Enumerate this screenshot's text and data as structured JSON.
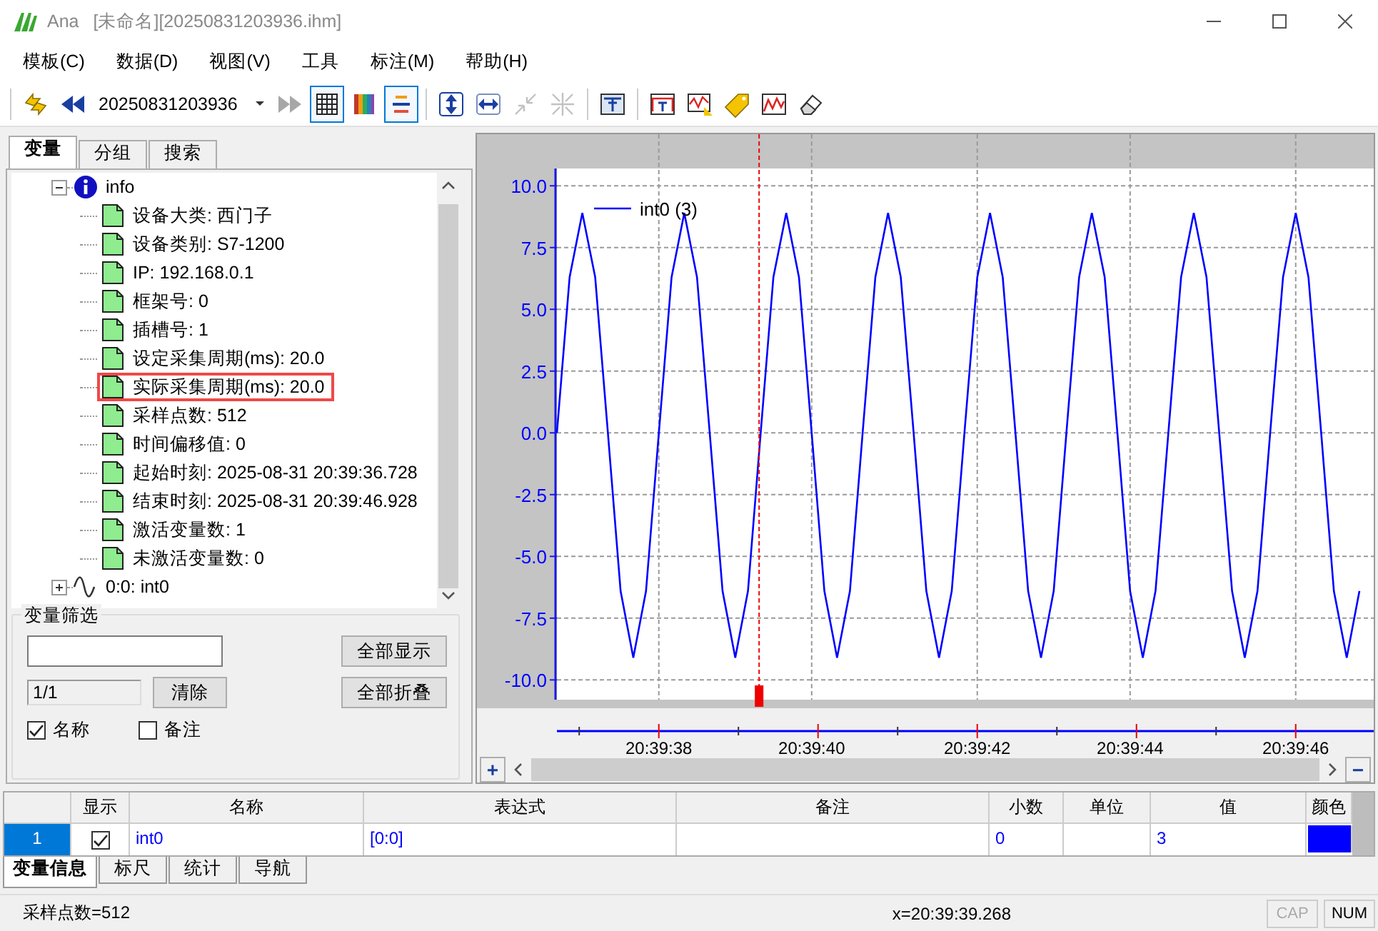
{
  "window": {
    "app": "Ana",
    "document": "[未命名][20250831203936.ihm]"
  },
  "menu": [
    "模板(C)",
    "数据(D)",
    "视图(V)",
    "工具",
    "标注(M)",
    "帮助(H)"
  ],
  "toolbar": {
    "combo_value": "20250831203936",
    "buttons": [
      {
        "pressed": false,
        "disabled": false
      },
      {
        "pressed": false,
        "disabled": false
      },
      {
        "pressed": false,
        "disabled": true
      },
      {
        "pressed": true,
        "disabled": false
      },
      {
        "pressed": false,
        "disabled": false
      },
      {
        "pressed": true,
        "disabled": false
      },
      {
        "pressed": false,
        "disabled": false
      },
      {
        "pressed": false,
        "disabled": false
      },
      {
        "pressed": false,
        "disabled": true
      },
      {
        "pressed": false,
        "disabled": true
      },
      {
        "pressed": false,
        "disabled": false
      },
      {
        "pressed": false,
        "disabled": false
      },
      {
        "pressed": false,
        "disabled": false
      },
      {
        "pressed": false,
        "disabled": false
      },
      {
        "pressed": false,
        "disabled": false
      },
      {
        "pressed": false,
        "disabled": false
      }
    ]
  },
  "left_tabs": [
    {
      "label": "变量",
      "selected": true
    },
    {
      "label": "分组",
      "selected": false
    },
    {
      "label": "搜索",
      "selected": false
    }
  ],
  "tree": [
    {
      "label": "info",
      "kind": "info",
      "expanded": true,
      "children": [
        {
          "label": "设备大类: 西门子",
          "highlighted": false
        },
        {
          "label": "设备类别: S7-1200",
          "highlighted": false
        },
        {
          "label": "IP: 192.168.0.1",
          "highlighted": false
        },
        {
          "label": "框架号: 0",
          "highlighted": false
        },
        {
          "label": "插槽号: 1",
          "highlighted": false
        },
        {
          "label": "设定采集周期(ms): 20.0",
          "highlighted": false
        },
        {
          "label": "实际采集周期(ms): 20.0",
          "highlighted": true
        },
        {
          "label": "采样点数: 512",
          "highlighted": false
        },
        {
          "label": "时间偏移值: 0",
          "highlighted": false
        },
        {
          "label": "起始时刻: 2025-08-31 20:39:36.728",
          "highlighted": false
        },
        {
          "label": "结束时刻: 2025-08-31 20:39:46.928",
          "highlighted": false
        },
        {
          "label": "激活变量数: 1",
          "highlighted": false
        },
        {
          "label": "未激活变量数: 0",
          "highlighted": false
        }
      ]
    },
    {
      "label": "0:0: int0",
      "kind": "signal",
      "expanded": false
    }
  ],
  "filter": {
    "title": "变量筛选",
    "count": "1/1",
    "clear_button": "清除",
    "show_all_button": "全部显示",
    "collapse_all_button": "全部折叠",
    "checkboxes": [
      {
        "label": "名称",
        "checked": true
      },
      {
        "label": "备注",
        "checked": false
      }
    ]
  },
  "chart_data": {
    "type": "line",
    "categories": [
      null,
      null,
      null,
      null,
      null,
      null,
      null,
      null,
      "20:39:38",
      null,
      null,
      null,
      null,
      null,
      null,
      null,
      null,
      null,
      null,
      null,
      "20:39:40",
      null,
      null,
      null,
      null,
      null,
      null,
      null,
      null,
      null,
      null,
      null,
      null,
      "20:39:42",
      null,
      null,
      null,
      null,
      null,
      null,
      null,
      null,
      null,
      null,
      null,
      "20:39:44",
      null,
      null,
      null,
      null,
      null,
      null,
      null,
      null,
      null,
      null,
      null,
      null,
      "20:39:46",
      null,
      null,
      null,
      null,
      null
    ],
    "series": [
      {
        "name": "int0 (3)",
        "color": "#0000ff",
        "values": [
          0,
          6.3,
          8.9,
          6.3,
          0,
          -6.4,
          -9.1,
          -6.4,
          0,
          6.3,
          8.9,
          6.3,
          0,
          -6.4,
          -9.1,
          -6.4,
          0,
          6.3,
          8.9,
          6.3,
          0,
          -6.4,
          -9.1,
          -6.4,
          0,
          6.3,
          8.9,
          6.3,
          0,
          -6.4,
          -9.1,
          -6.4,
          0,
          6.3,
          8.9,
          6.3,
          0,
          -6.4,
          -9.1,
          -6.4,
          0,
          6.3,
          8.9,
          6.3,
          0,
          -6.4,
          -9.1,
          -6.4,
          0,
          6.3,
          8.9,
          6.3,
          0,
          -6.4,
          -9.1,
          -6.4,
          0,
          6.3,
          8.9,
          6.3,
          0,
          -6.4,
          -9.1,
          -6.4
        ]
      }
    ],
    "ylim": [
      -10.8,
      10.7
    ],
    "yticks": [
      {
        "value": 10,
        "label": "10.0"
      },
      {
        "value": 7.5,
        "label": "7.5"
      },
      {
        "value": 5,
        "label": "5.0"
      },
      {
        "value": 2.5,
        "label": "2.5"
      },
      {
        "value": 0,
        "label": "0.0"
      },
      {
        "value": -2.5,
        "label": "-2.5"
      },
      {
        "value": -5,
        "label": "-5.0"
      },
      {
        "value": -7.5,
        "label": "-7.5"
      },
      {
        "value": -10,
        "label": "-10.0"
      }
    ],
    "grid": true
  },
  "chart_scroll": {
    "zoom_in": "+",
    "zoom_out": "−"
  },
  "table": {
    "columns": [
      "显示",
      "名称",
      "表达式",
      "备注",
      "小数",
      "单位",
      "值",
      "颜色"
    ],
    "rows": [
      {
        "index": "1",
        "selected": true,
        "shown": true,
        "name": "int0",
        "expression": "[0:0]",
        "decimals": "0",
        "value": "3",
        "color": "#0000ff"
      }
    ]
  },
  "bottom_tabs": [
    {
      "label": "变量信息",
      "selected": true
    },
    {
      "label": "标尺",
      "selected": false
    },
    {
      "label": "统计",
      "selected": false
    },
    {
      "label": "导航",
      "selected": false
    }
  ],
  "status_bar": {
    "samples": "采样点数=512",
    "cursor": "x=20:39:39.268",
    "indicators": [
      {
        "label": "CAP",
        "on": false
      },
      {
        "label": "NUM",
        "on": true
      }
    ]
  }
}
